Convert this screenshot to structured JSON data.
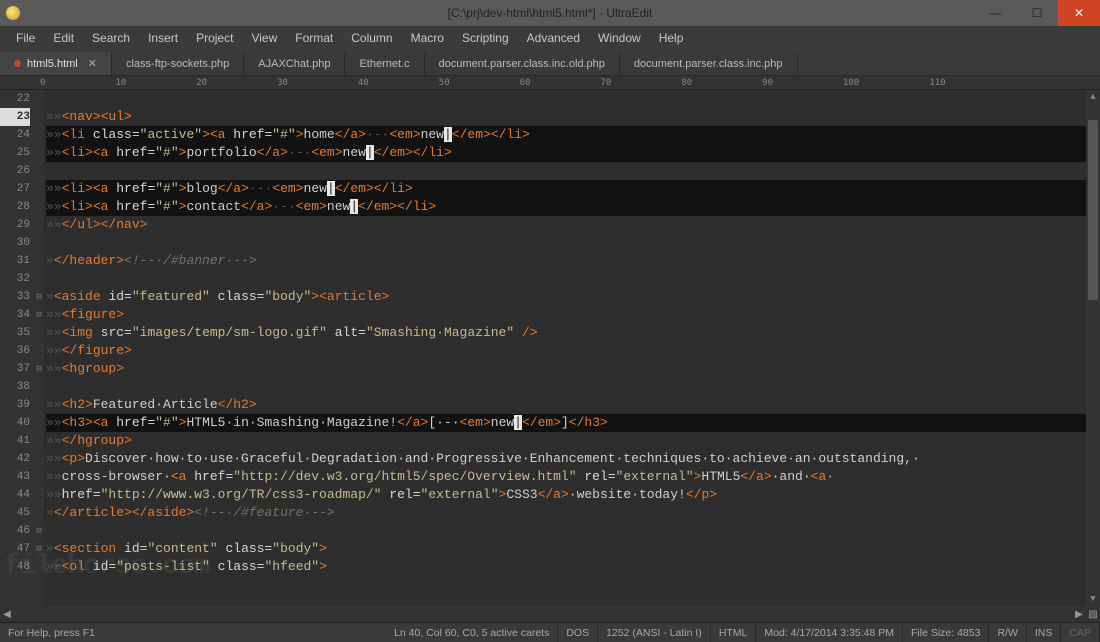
{
  "window": {
    "title": "[C:\\prj\\dev-html\\html5.html*] - UltraEdit",
    "min": "—",
    "max": "☐",
    "close": "✕"
  },
  "menu": [
    "File",
    "Edit",
    "Search",
    "Insert",
    "Project",
    "View",
    "Format",
    "Column",
    "Macro",
    "Scripting",
    "Advanced",
    "Window",
    "Help"
  ],
  "tabs": [
    {
      "label": "html5.html",
      "active": true,
      "dirty": true
    },
    {
      "label": "class-ftp-sockets.php"
    },
    {
      "label": "AJAXChat.php"
    },
    {
      "label": "Ethernet.c"
    },
    {
      "label": "document.parser.class.inc.old.php"
    },
    {
      "label": "document.parser.class.inc.php"
    }
  ],
  "ruler": [
    "0",
    "10",
    "20",
    "30",
    "40",
    "50",
    "60",
    "70",
    "80",
    "90",
    "100",
    "110"
  ],
  "gutter_start": 22,
  "highlighted_line": 23,
  "status": {
    "help": "For Help, press F1",
    "pos": "Ln 40, Col 60, C0, 5 active carets",
    "eol": "DOS",
    "enc": "1252 (ANSI - Latin I)",
    "lang": "HTML",
    "mod": "Mod: 4/17/2014 3:35:48 PM",
    "size": "File Size: 4853",
    "rw": "R/W",
    "ins": "INS",
    "cap": "CAP"
  },
  "watermark": "filehorse.com",
  "code": [
    {
      "html": ""
    },
    {
      "html": "<span class='t-ws'>»»</span><span class='t-tag'>&lt;nav&gt;&lt;ul&gt;</span>"
    },
    {
      "sel": true,
      "html": "<span class='t-ws'>»»</span><span class='t-tag'>&lt;li</span> <span class='t-attr'>class=</span><span class='t-str'>\"active\"</span><span class='t-tag'>&gt;&lt;a</span> <span class='t-attr'>href=</span><span class='t-str'>\"#\"</span><span class='t-tag'>&gt;</span><span class='t-txt'>home</span><span class='t-tag'>&lt;/a&gt;</span><span class='t-ws'>·-·</span><span class='t-tag'>&lt;em&gt;</span><span class='t-txt'>new</span><span class='caret'>|</span><span class='t-tag'>&lt;/em&gt;&lt;/li&gt;</span>"
    },
    {
      "sel": true,
      "html": "<span class='t-ws'>»»</span><span class='t-tag'>&lt;li&gt;&lt;a</span> <span class='t-attr'>href=</span><span class='t-str'>\"#\"</span><span class='t-tag'>&gt;</span><span class='t-txt'>portfolio</span><span class='t-tag'>&lt;/a&gt;</span><span class='t-ws'>·-·</span><span class='t-tag'>&lt;em&gt;</span><span class='t-txt'>new</span><span class='caret'>|</span><span class='t-tag'>&lt;/em&gt;&lt;/li&gt;</span>"
    },
    {
      "html": ""
    },
    {
      "sel": true,
      "html": "<span class='t-ws'>»»</span><span class='t-tag'>&lt;li&gt;&lt;a</span> <span class='t-attr'>href=</span><span class='t-str'>\"#\"</span><span class='t-tag'>&gt;</span><span class='t-txt'>blog</span><span class='t-tag'>&lt;/a&gt;</span><span class='t-ws'>·-·</span><span class='t-tag'>&lt;em&gt;</span><span class='t-txt'>new</span><span class='caret'>|</span><span class='t-tag'>&lt;/em&gt;&lt;/li&gt;</span>"
    },
    {
      "sel": true,
      "html": "<span class='t-ws'>»»</span><span class='t-tag'>&lt;li&gt;&lt;a</span> <span class='t-attr'>href=</span><span class='t-str'>\"#\"</span><span class='t-tag'>&gt;</span><span class='t-txt'>contact</span><span class='t-tag'>&lt;/a&gt;</span><span class='t-ws'>·-·</span><span class='t-tag'>&lt;em&gt;</span><span class='t-txt'>new</span><span class='caret'>|</span><span class='t-tag'>&lt;/em&gt;&lt;/li&gt;</span>"
    },
    {
      "html": "<span class='t-ws'>»»</span><span class='t-tag'>&lt;/ul&gt;&lt;/nav&gt;</span>"
    },
    {
      "html": ""
    },
    {
      "html": "<span class='t-ws'>»</span><span class='t-tag'>&lt;/header&gt;</span><span class='t-cmt'>&lt;!--·/#banner·--&gt;</span>"
    },
    {
      "html": ""
    },
    {
      "html": "<span class='t-ws'>»</span><span class='t-tag'>&lt;aside</span> <span class='t-attr'>id=</span><span class='t-str'>\"featured\"</span> <span class='t-attr'>class=</span><span class='t-str'>\"body\"</span><span class='t-tag'>&gt;&lt;article&gt;</span>"
    },
    {
      "html": "<span class='t-ws'>»»</span><span class='t-tag'>&lt;figure&gt;</span>"
    },
    {
      "html": "<span class='t-ws'>»»</span><span class='t-tag'>&lt;img</span> <span class='t-attr'>src=</span><span class='t-str'>\"images/temp/sm-logo.gif\"</span> <span class='t-attr'>alt=</span><span class='t-str'>\"Smashing·Magazine\"</span> <span class='t-tag'>/&gt;</span>"
    },
    {
      "html": "<span class='t-ws'>»»</span><span class='t-tag'>&lt;/figure&gt;</span>"
    },
    {
      "html": "<span class='t-ws'>»»</span><span class='t-tag'>&lt;hgroup&gt;</span>"
    },
    {
      "html": ""
    },
    {
      "html": "<span class='t-ws'>»»</span><span class='t-tag'>&lt;h2&gt;</span><span class='t-txt'>Featured·Article</span><span class='t-tag'>&lt;/h2&gt;</span>"
    },
    {
      "sel": true,
      "html": "<span class='t-ws'>»»</span><span class='t-tag'>&lt;h3&gt;&lt;a</span> <span class='t-attr'>href=</span><span class='t-str'>\"#\"</span><span class='t-tag'>&gt;</span><span class='t-txt'>HTML5·in·Smashing·Magazine!</span><span class='t-tag'>&lt;/a&gt;</span><span class='t-txt'>[·-·</span><span class='t-tag'>&lt;em&gt;</span><span class='t-txt'>new</span><span class='caret'>|</span><span class='t-tag'>&lt;/em&gt;</span><span class='t-txt'>]</span><span class='t-tag'>&lt;/h3&gt;</span>"
    },
    {
      "html": "<span class='t-ws'>»»</span><span class='t-tag'>&lt;/hgroup&gt;</span>"
    },
    {
      "html": "<span class='t-ws'>»»</span><span class='t-tag'>&lt;p&gt;</span><span class='t-txt'>Discover·how·to·use·Graceful·Degradation·and·Progressive·Enhancement·techniques·to·achieve·an·outstanding,·</span>"
    },
    {
      "html": "<span class='t-ws'>»»</span><span class='t-txt'>cross-browser·</span><span class='t-tag'>&lt;a</span> <span class='t-attr'>href=</span><span class='t-str'>\"http://dev.w3.org/html5/spec/Overview.html\"</span> <span class='t-attr'>rel=</span><span class='t-str'>\"external\"</span><span class='t-tag'>&gt;</span><span class='t-txt'>HTML5</span><span class='t-tag'>&lt;/a&gt;</span><span class='t-txt'>·and·</span><span class='t-tag'>&lt;a</span>·"
    },
    {
      "html": "<span class='t-ws'>»»</span><span class='t-attr'>href=</span><span class='t-str'>\"http://www.w3.org/TR/css3-roadmap/\"</span> <span class='t-attr'>rel=</span><span class='t-str'>\"external\"</span><span class='t-tag'>&gt;</span><span class='t-txt'>CSS3</span><span class='t-tag'>&lt;/a&gt;</span><span class='t-txt'>·website·today!</span><span class='t-tag'>&lt;/p&gt;</span>"
    },
    {
      "html": "<span class='t-ws'>»</span><span class='t-tag'>&lt;/article&gt;&lt;/aside&gt;</span><span class='t-cmt'>&lt;!--·/#feature·--&gt;</span>"
    },
    {
      "html": ""
    },
    {
      "html": "<span class='t-ws'>»</span><span class='t-tag'>&lt;section</span> <span class='t-attr'>id=</span><span class='t-str'>\"content\"</span> <span class='t-attr'>class=</span><span class='t-str'>\"body\"</span><span class='t-tag'>&gt;</span>"
    },
    {
      "html": "<span class='t-ws'>»»</span><span class='t-tag'>&lt;ol</span> <span class='t-attr'>id=</span><span class='t-str'>\"posts-list\"</span> <span class='t-attr'>class=</span><span class='t-str'>\"hfeed\"</span><span class='t-tag'>&gt;</span>"
    }
  ]
}
